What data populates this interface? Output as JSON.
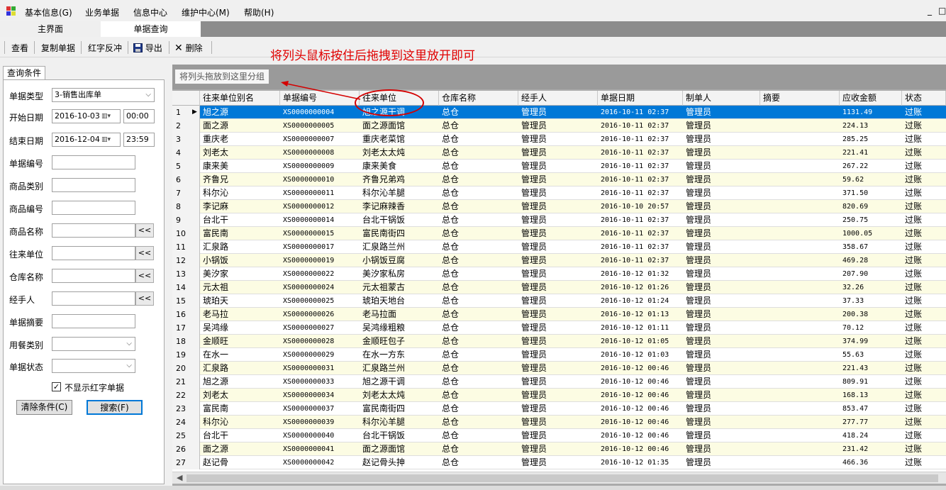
{
  "menu": {
    "items": [
      "基本信息(G)",
      "业务单据",
      "信息中心",
      "维护中心(M)",
      "帮助(H)"
    ],
    "window_buttons": [
      "_",
      "□"
    ]
  },
  "tabs": [
    "主界面",
    "单据查询"
  ],
  "toolbar": {
    "view": "查看",
    "copy": "复制单据",
    "redflush": "红字反冲",
    "export": "导出",
    "delete": "删除"
  },
  "annotation": "将列头鼠标按住后拖拽到这里放开即可",
  "query": {
    "tab": "查询条件",
    "labels": {
      "doc_type": "单据类型",
      "start_date": "开始日期",
      "end_date": "结束日期",
      "doc_no": "单据编号",
      "category": "商品类别",
      "product_no": "商品编号",
      "product_name": "商品名称",
      "partner": "往来单位",
      "warehouse": "仓库名称",
      "handler": "经手人",
      "summary": "单据摘要",
      "meal_type": "用餐类别",
      "doc_status": "单据状态"
    },
    "doc_type_value": "3-销售出库单",
    "start_date": "2016-10-03",
    "start_time": "00:00",
    "end_date": "2016-12-04",
    "end_time": "23:59",
    "mini_btn": "<<",
    "checkbox_label": "不显示红字单据",
    "clear_button": "清除条件(C)",
    "search_button": "搜索(F)"
  },
  "group_hint": "将列头拖放到这里分组",
  "grid": {
    "columns": [
      "往来单位别名",
      "单据编号",
      "往来单位",
      "仓库名称",
      "经手人",
      "单据日期",
      "制单人",
      "摘要",
      "应收金额",
      "状态"
    ],
    "rows": [
      [
        "1",
        "旭之源",
        "XS0000000004",
        "旭之源干调",
        "总仓",
        "管理员",
        "2016-10-11 02:37",
        "管理员",
        "",
        "1131.49",
        "过账"
      ],
      [
        "2",
        "面之源",
        "XS0000000005",
        "面之源面馆",
        "总仓",
        "管理员",
        "2016-10-11 02:37",
        "管理员",
        "",
        "224.13",
        "过账"
      ],
      [
        "3",
        "重庆老",
        "XS0000000007",
        "重庆老菜馆",
        "总仓",
        "管理员",
        "2016-10-11 02:37",
        "管理员",
        "",
        "285.25",
        "过账"
      ],
      [
        "4",
        "刘老太",
        "XS0000000008",
        "刘老太太炖",
        "总仓",
        "管理员",
        "2016-10-11 02:37",
        "管理员",
        "",
        "221.41",
        "过账"
      ],
      [
        "5",
        "康来美",
        "XS0000000009",
        "康来美食",
        "总仓",
        "管理员",
        "2016-10-11 02:37",
        "管理员",
        "",
        "267.22",
        "过账"
      ],
      [
        "6",
        "齐鲁兄",
        "XS0000000010",
        "齐鲁兄弟鸡",
        "总仓",
        "管理员",
        "2016-10-11 02:37",
        "管理员",
        "",
        "59.62",
        "过账"
      ],
      [
        "7",
        "科尔沁",
        "XS0000000011",
        "科尔沁羊腿",
        "总仓",
        "管理员",
        "2016-10-11 02:37",
        "管理员",
        "",
        "371.50",
        "过账"
      ],
      [
        "8",
        "李记麻",
        "XS0000000012",
        "李记麻辣香",
        "总仓",
        "管理员",
        "2016-10-10 20:57",
        "管理员",
        "",
        "820.69",
        "过账"
      ],
      [
        "9",
        "台北干",
        "XS0000000014",
        "台北干锅饭",
        "总仓",
        "管理员",
        "2016-10-11 02:37",
        "管理员",
        "",
        "250.75",
        "过账"
      ],
      [
        "10",
        "富民南",
        "XS0000000015",
        "富民南街四",
        "总仓",
        "管理员",
        "2016-10-11 02:37",
        "管理员",
        "",
        "1000.05",
        "过账"
      ],
      [
        "11",
        "汇泉路",
        "XS0000000017",
        "汇泉路兰州",
        "总仓",
        "管理员",
        "2016-10-11 02:37",
        "管理员",
        "",
        "358.67",
        "过账"
      ],
      [
        "12",
        "小锅饭",
        "XS0000000019",
        "小锅饭豆腐",
        "总仓",
        "管理员",
        "2016-10-11 02:37",
        "管理员",
        "",
        "469.28",
        "过账"
      ],
      [
        "13",
        "美汐家",
        "XS0000000022",
        "美汐家私房",
        "总仓",
        "管理员",
        "2016-10-12 01:32",
        "管理员",
        "",
        "207.90",
        "过账"
      ],
      [
        "14",
        "元太祖",
        "XS0000000024",
        "元太祖蒙古",
        "总仓",
        "管理员",
        "2016-10-12 01:26",
        "管理员",
        "",
        "32.26",
        "过账"
      ],
      [
        "15",
        "琥珀天",
        "XS0000000025",
        "琥珀天地台",
        "总仓",
        "管理员",
        "2016-10-12 01:24",
        "管理员",
        "",
        "37.33",
        "过账"
      ],
      [
        "16",
        "老马拉",
        "XS0000000026",
        "老马拉面",
        "总仓",
        "管理员",
        "2016-10-12 01:13",
        "管理员",
        "",
        "200.38",
        "过账"
      ],
      [
        "17",
        "吴鸿缘",
        "XS0000000027",
        "吴鸿缘粗粮",
        "总仓",
        "管理员",
        "2016-10-12 01:11",
        "管理员",
        "",
        "70.12",
        "过账"
      ],
      [
        "18",
        "金顺旺",
        "XS0000000028",
        "金顺旺包子",
        "总仓",
        "管理员",
        "2016-10-12 01:05",
        "管理员",
        "",
        "374.99",
        "过账"
      ],
      [
        "19",
        "在水一",
        "XS0000000029",
        "在水一方东",
        "总仓",
        "管理员",
        "2016-10-12 01:03",
        "管理员",
        "",
        "55.63",
        "过账"
      ],
      [
        "20",
        "汇泉路",
        "XS0000000031",
        "汇泉路兰州",
        "总仓",
        "管理员",
        "2016-10-12 00:46",
        "管理员",
        "",
        "221.43",
        "过账"
      ],
      [
        "21",
        "旭之源",
        "XS0000000033",
        "旭之源干调",
        "总仓",
        "管理员",
        "2016-10-12 00:46",
        "管理员",
        "",
        "809.91",
        "过账"
      ],
      [
        "22",
        "刘老太",
        "XS0000000034",
        "刘老太太炖",
        "总仓",
        "管理员",
        "2016-10-12 00:46",
        "管理员",
        "",
        "168.13",
        "过账"
      ],
      [
        "23",
        "富民南",
        "XS0000000037",
        "富民南街四",
        "总仓",
        "管理员",
        "2016-10-12 00:46",
        "管理员",
        "",
        "853.47",
        "过账"
      ],
      [
        "24",
        "科尔沁",
        "XS0000000039",
        "科尔沁羊腿",
        "总仓",
        "管理员",
        "2016-10-12 00:46",
        "管理员",
        "",
        "277.77",
        "过账"
      ],
      [
        "25",
        "台北干",
        "XS0000000040",
        "台北干锅饭",
        "总仓",
        "管理员",
        "2016-10-12 00:46",
        "管理员",
        "",
        "418.24",
        "过账"
      ],
      [
        "26",
        "面之源",
        "XS0000000041",
        "面之源面馆",
        "总仓",
        "管理员",
        "2016-10-12 00:46",
        "管理员",
        "",
        "231.42",
        "过账"
      ],
      [
        "27",
        "赵记骨",
        "XS0000000042",
        "赵记骨头抻",
        "总仓",
        "管理员",
        "2016-10-12 01:35",
        "管理员",
        "",
        "466.36",
        "过账"
      ]
    ],
    "selected_row": 0
  },
  "colors": {
    "selection": "#0078d7",
    "alt_row": "#fcfce3",
    "annotation": "#e00000"
  }
}
